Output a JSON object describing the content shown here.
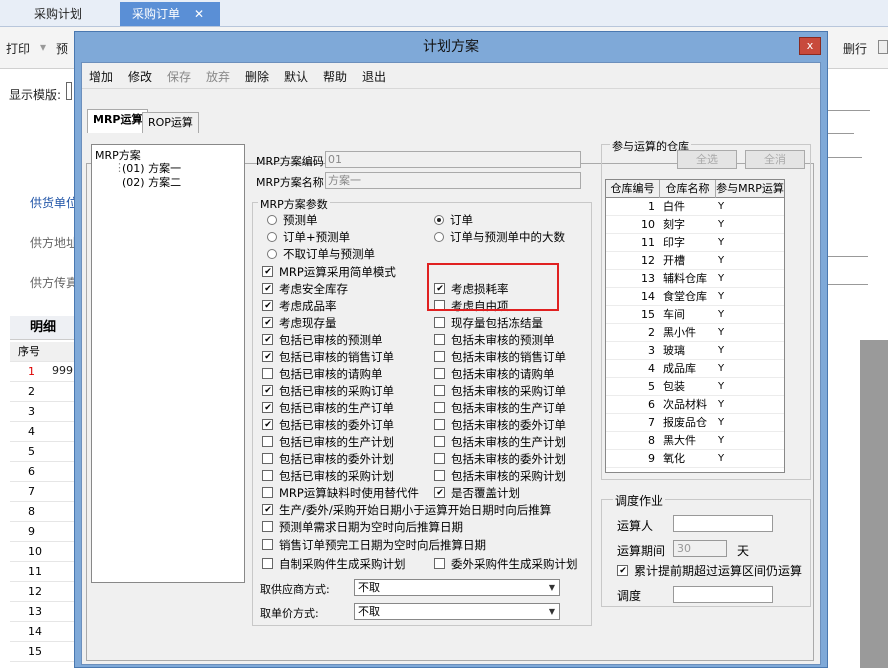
{
  "app": {
    "tabs": [
      "采购计划",
      "采购订单"
    ],
    "tab_close": "✕",
    "toolbar": {
      "print": "打印",
      "preview": "预",
      "delete_row": "删行"
    },
    "template_label": "显示模版:",
    "fields": [
      "供货单位",
      "供方地址",
      "供方传真"
    ],
    "detail_tab": "明细",
    "grid_header": "序号",
    "grid_first_value": "999",
    "grid_rows": [
      "1",
      "2",
      "3",
      "4",
      "5",
      "6",
      "7",
      "8",
      "9",
      "10",
      "11",
      "12",
      "13",
      "14",
      "15"
    ]
  },
  "dialog": {
    "title": "计划方案",
    "close_label": "x",
    "menu": [
      {
        "label": "增加",
        "enabled": true
      },
      {
        "label": "修改",
        "enabled": true
      },
      {
        "label": "保存",
        "enabled": false
      },
      {
        "label": "放弃",
        "enabled": false
      },
      {
        "label": "删除",
        "enabled": true
      },
      {
        "label": "默认",
        "enabled": true
      },
      {
        "label": "帮助",
        "enabled": true
      },
      {
        "label": "退出",
        "enabled": true
      }
    ],
    "tabs": [
      "MRP运算",
      "ROP运算"
    ],
    "tree": {
      "root": "MRP方案",
      "children": [
        "(01) 方案一",
        "(02) 方案二"
      ]
    },
    "scheme_code_label": "MRP方案编码",
    "scheme_code_value": "01",
    "scheme_name_label": "MRP方案名称",
    "scheme_name_value": "方案一",
    "params_title": "MRP方案参数",
    "radios": [
      {
        "label": "预测单",
        "checked": false
      },
      {
        "label": "订单",
        "checked": true
      },
      {
        "label": "订单+预测单",
        "checked": false
      },
      {
        "label": "订单与预测单中的大数",
        "checked": false
      },
      {
        "label": "不取订单与预测单",
        "checked": false
      }
    ],
    "checks_left": [
      {
        "label": "MRP运算采用简单模式",
        "checked": true
      },
      {
        "label": "考虑安全库存",
        "checked": true
      },
      {
        "label": "考虑成品率",
        "checked": true
      },
      {
        "label": "考虑现存量",
        "checked": true
      },
      {
        "label": "包括已审核的预测单",
        "checked": true
      },
      {
        "label": "包括已审核的销售订单",
        "checked": true
      },
      {
        "label": "包括已审核的请购单",
        "checked": false
      },
      {
        "label": "包括已审核的采购订单",
        "checked": true
      },
      {
        "label": "包括已审核的生产订单",
        "checked": true
      },
      {
        "label": "包括已审核的委外订单",
        "checked": true
      },
      {
        "label": "包括已审核的生产计划",
        "checked": false
      },
      {
        "label": "包括已审核的委外计划",
        "checked": false
      },
      {
        "label": "包括已审核的采购计划",
        "checked": false
      },
      {
        "label": "MRP运算缺料时使用替代件",
        "checked": false
      }
    ],
    "checks_right": [
      {
        "label": "考虑损耗率",
        "checked": true
      },
      {
        "label": "考虑自由项",
        "checked": false
      },
      {
        "label": "现存量包括冻结量",
        "checked": false
      },
      {
        "label": "包括未审核的预测单",
        "checked": false
      },
      {
        "label": "包括未审核的销售订单",
        "checked": false
      },
      {
        "label": "包括未审核的请购单",
        "checked": false
      },
      {
        "label": "包括未审核的采购订单",
        "checked": false
      },
      {
        "label": "包括未审核的生产订单",
        "checked": false
      },
      {
        "label": "包括未审核的委外订单",
        "checked": false
      },
      {
        "label": "包括未审核的生产计划",
        "checked": false
      },
      {
        "label": "包括未审核的委外计划",
        "checked": false
      },
      {
        "label": "包括未审核的采购计划",
        "checked": false
      },
      {
        "label": "是否覆盖计划",
        "checked": true
      }
    ],
    "checks_bottom": [
      {
        "label": "生产/委外/采购开始日期小于运算开始日期时向后推算",
        "checked": true
      },
      {
        "label": "预测单需求日期为空时向后推算日期",
        "checked": false
      },
      {
        "label": "销售订单预完工日期为空时向后推算日期",
        "checked": false
      }
    ],
    "check_self_made": {
      "label": "自制采购件生成采购计划",
      "checked": false
    },
    "check_outsourced": {
      "label": "委外采购件生成采购计划",
      "checked": false
    },
    "supplier_mode_label": "取供应商方式:",
    "supplier_mode_value": "不取",
    "price_mode_label": "取单价方式:",
    "price_mode_value": "不取",
    "warehouse": {
      "title": "参与运算的仓库",
      "select_all": "全选",
      "clear_all": "全消",
      "columns": [
        "仓库编号",
        "仓库名称",
        "参与MRP运算"
      ],
      "rows": [
        {
          "no": "1",
          "name": "白件",
          "flag": "Y"
        },
        {
          "no": "10",
          "name": "刻字",
          "flag": "Y"
        },
        {
          "no": "11",
          "name": "印字",
          "flag": "Y"
        },
        {
          "no": "12",
          "name": "开槽",
          "flag": "Y"
        },
        {
          "no": "13",
          "name": "辅料仓库",
          "flag": "Y"
        },
        {
          "no": "14",
          "name": "食堂仓库",
          "flag": "Y"
        },
        {
          "no": "15",
          "name": "车间",
          "flag": "Y"
        },
        {
          "no": "2",
          "name": "黑小件",
          "flag": "Y"
        },
        {
          "no": "3",
          "name": "玻璃",
          "flag": "Y"
        },
        {
          "no": "4",
          "name": "成品库",
          "flag": "Y"
        },
        {
          "no": "5",
          "name": "包装",
          "flag": "Y"
        },
        {
          "no": "6",
          "name": "次品材料",
          "flag": "Y"
        },
        {
          "no": "7",
          "name": "报废品仓",
          "flag": "Y"
        },
        {
          "no": "8",
          "name": "黑大件",
          "flag": "Y"
        },
        {
          "no": "9",
          "name": "氧化",
          "flag": "Y"
        }
      ]
    },
    "schedule": {
      "title": "调度作业",
      "operator_label": "运算人",
      "period_label": "运算期间",
      "period_value": "30",
      "period_unit": "天",
      "cumulative_label": "累计提前期超过运算区间仍运算",
      "cumulative_checked": true,
      "dispatch_label": "调度"
    }
  }
}
